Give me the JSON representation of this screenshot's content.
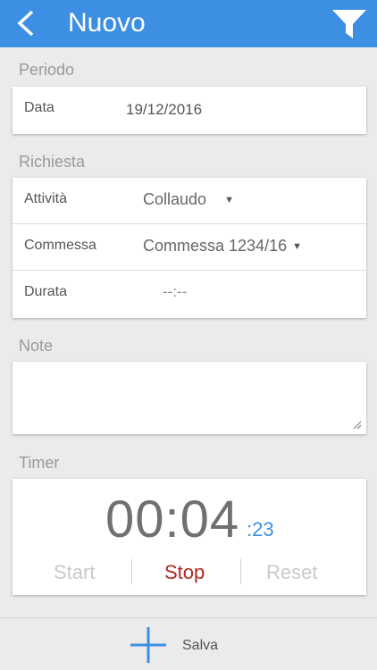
{
  "header": {
    "title": "Nuovo",
    "back_icon": "chevron-left-icon",
    "filter_icon": "filter-funnel-icon",
    "color": "#3d8fe3"
  },
  "periodo": {
    "section_label": "Periodo",
    "data_label": "Data",
    "data_value": "19/12/2016"
  },
  "richiesta": {
    "section_label": "Richiesta",
    "attivita_label": "Attività",
    "attivita_value": "Collaudo",
    "commessa_label": "Commessa",
    "commessa_value": "Commessa 1234/16",
    "durata_label": "Durata",
    "durata_value": "--:--"
  },
  "note": {
    "section_label": "Note",
    "value": ""
  },
  "timer": {
    "section_label": "Timer",
    "main": "00:04",
    "sub": ":23",
    "start_label": "Start",
    "stop_label": "Stop",
    "reset_label": "Reset",
    "stop_color": "#b02a20"
  },
  "footer": {
    "save_label": "Salva",
    "save_icon": "plus-icon"
  }
}
